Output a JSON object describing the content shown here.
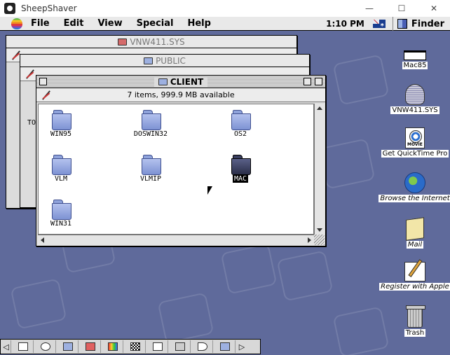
{
  "host": {
    "title": "SheepShaver",
    "controls": {
      "minimize": "—",
      "maximize": "☐",
      "close": "✕"
    }
  },
  "menubar": {
    "apple_icon": "apple-rainbow-icon",
    "items": [
      {
        "label": "File"
      },
      {
        "label": "Edit"
      },
      {
        "label": "View"
      },
      {
        "label": "Special"
      },
      {
        "label": "Help"
      }
    ],
    "clock": "1:10 PM",
    "flag_icon": "australia-flag-icon",
    "active_app": "Finder"
  },
  "windows": {
    "vnw": {
      "title": "VNW411.SYS"
    },
    "public": {
      "title": "PUBLIC",
      "peek_text": "TO"
    },
    "client": {
      "title": "CLIENT",
      "info": "7 items, 999.9 MB available",
      "items": [
        {
          "label": "WIN95",
          "selected": false
        },
        {
          "label": "DOSWIN32",
          "selected": false
        },
        {
          "label": "OS2",
          "selected": false
        },
        {
          "label": "VLM",
          "selected": false
        },
        {
          "label": "VLMIP",
          "selected": false
        },
        {
          "label": "MAC",
          "selected": true
        },
        {
          "label": "WIN31",
          "selected": false
        }
      ]
    }
  },
  "desktop_icons": [
    {
      "label": "Mac85",
      "icon": "hard-disk-icon"
    },
    {
      "label": "VNW411.SYS",
      "icon": "system-file-icon"
    },
    {
      "label": "Get QuickTime Pro",
      "icon": "quicktime-icon"
    },
    {
      "label": "Browse the Internet",
      "icon": "globe-icon"
    },
    {
      "label": "Mail",
      "icon": "mail-icon"
    },
    {
      "label": "Register with Apple",
      "icon": "register-icon"
    },
    {
      "label": "Trash",
      "icon": "trash-icon"
    }
  ],
  "control_strip": {
    "items": [
      "monitor-icon",
      "cd-icon",
      "file-sharing-icon",
      "appletalk-icon",
      "colors-icon",
      "resolution-icon",
      "printer-icon",
      "sound-icon",
      "speaker-icon",
      "remote-icon"
    ]
  }
}
